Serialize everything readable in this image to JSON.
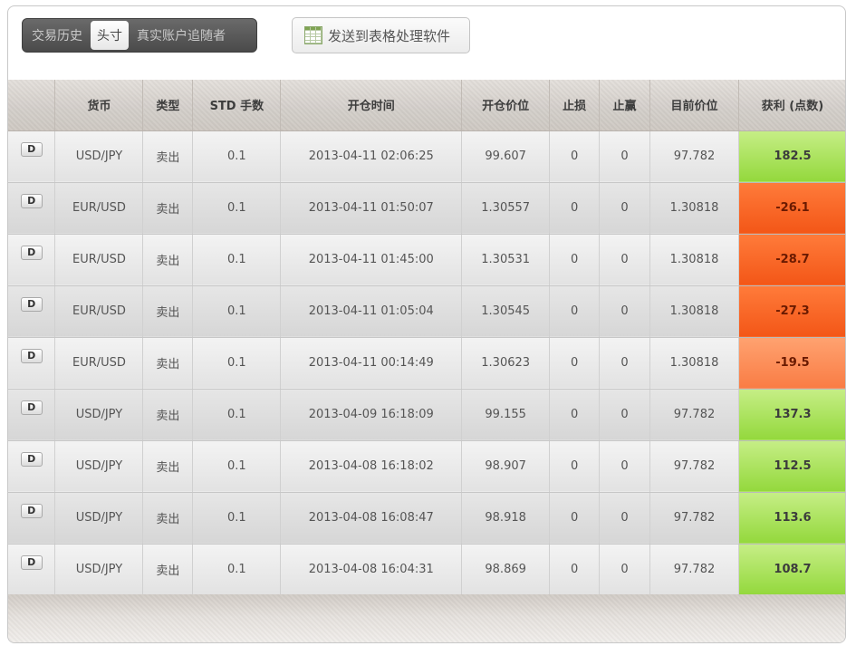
{
  "tabs": [
    {
      "label": "交易历史",
      "active": false
    },
    {
      "label": "头寸",
      "active": true
    },
    {
      "label": "真实账户追随者",
      "active": false
    }
  ],
  "export_button": {
    "label": "发送到表格处理软件",
    "icon": "spreadsheet-icon"
  },
  "table": {
    "columns": [
      "",
      "货币",
      "类型",
      "STD 手数",
      "开仓时间",
      "开仓价位",
      "止损",
      "止赢",
      "目前价位",
      "获利 (点数)"
    ],
    "action_label": "D",
    "rows": [
      {
        "currency": "USD/JPY",
        "type": "卖出",
        "lots": "0.1",
        "open_time": "2013-04-11 02:06:25",
        "open_price": "99.607",
        "stop_loss": "0",
        "take_profit": "0",
        "current_price": "97.782",
        "profit": "182.5",
        "profit_status": "positive"
      },
      {
        "currency": "EUR/USD",
        "type": "卖出",
        "lots": "0.1",
        "open_time": "2013-04-11 01:50:07",
        "open_price": "1.30557",
        "stop_loss": "0",
        "take_profit": "0",
        "current_price": "1.30818",
        "profit": "-26.1",
        "profit_status": "negative"
      },
      {
        "currency": "EUR/USD",
        "type": "卖出",
        "lots": "0.1",
        "open_time": "2013-04-11 01:45:00",
        "open_price": "1.30531",
        "stop_loss": "0",
        "take_profit": "0",
        "current_price": "1.30818",
        "profit": "-28.7",
        "profit_status": "negative"
      },
      {
        "currency": "EUR/USD",
        "type": "卖出",
        "lots": "0.1",
        "open_time": "2013-04-11 01:05:04",
        "open_price": "1.30545",
        "stop_loss": "0",
        "take_profit": "0",
        "current_price": "1.30818",
        "profit": "-27.3",
        "profit_status": "negative"
      },
      {
        "currency": "EUR/USD",
        "type": "卖出",
        "lots": "0.1",
        "open_time": "2013-04-11 00:14:49",
        "open_price": "1.30623",
        "stop_loss": "0",
        "take_profit": "0",
        "current_price": "1.30818",
        "profit": "-19.5",
        "profit_status": "negative-light"
      },
      {
        "currency": "USD/JPY",
        "type": "卖出",
        "lots": "0.1",
        "open_time": "2013-04-09 16:18:09",
        "open_price": "99.155",
        "stop_loss": "0",
        "take_profit": "0",
        "current_price": "97.782",
        "profit": "137.3",
        "profit_status": "positive"
      },
      {
        "currency": "USD/JPY",
        "type": "卖出",
        "lots": "0.1",
        "open_time": "2013-04-08 16:18:02",
        "open_price": "98.907",
        "stop_loss": "0",
        "take_profit": "0",
        "current_price": "97.782",
        "profit": "112.5",
        "profit_status": "positive"
      },
      {
        "currency": "USD/JPY",
        "type": "卖出",
        "lots": "0.1",
        "open_time": "2013-04-08 16:08:47",
        "open_price": "98.918",
        "stop_loss": "0",
        "take_profit": "0",
        "current_price": "97.782",
        "profit": "113.6",
        "profit_status": "positive"
      },
      {
        "currency": "USD/JPY",
        "type": "卖出",
        "lots": "0.1",
        "open_time": "2013-04-08 16:04:31",
        "open_price": "98.869",
        "stop_loss": "0",
        "take_profit": "0",
        "current_price": "97.782",
        "profit": "108.7",
        "profit_status": "positive"
      }
    ]
  },
  "colors": {
    "positive": "#a8e25a",
    "negative": "#f85f22",
    "negative_light": "#fb8c55"
  }
}
